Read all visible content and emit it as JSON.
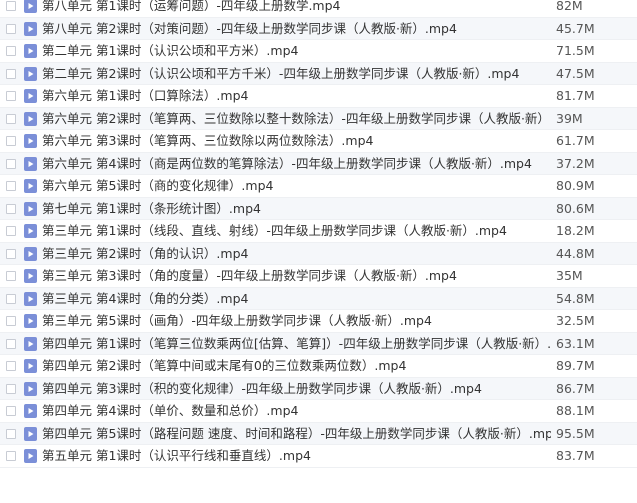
{
  "files": [
    {
      "name": "第八单元 第1课时（运筹问题）-四年级上册数学.mp4",
      "size": "82M",
      "icon": "video-file-icon"
    },
    {
      "name": "第八单元 第2课时（对策问题）-四年级上册数学同步课（人教版·新）.mp4",
      "size": "45.7M",
      "icon": "video-file-icon"
    },
    {
      "name": "第二单元 第1课时（认识公顷和平方米）.mp4",
      "size": "71.5M",
      "icon": "video-file-icon"
    },
    {
      "name": "第二单元 第2课时（认识公顷和平方千米）-四年级上册数学同步课（人教版·新）.mp4",
      "size": "47.5M",
      "icon": "video-file-icon"
    },
    {
      "name": "第六单元 第1课时（口算除法）.mp4",
      "size": "81.7M",
      "icon": "video-file-icon"
    },
    {
      "name": "第六单元 第2课时（笔算两、三位数除以整十数除法）-四年级上册数学同步课（人教版·新）.mp4",
      "size": "39M",
      "icon": "video-file-icon"
    },
    {
      "name": "第六单元 第3课时（笔算两、三位数除以两位数除法）.mp4",
      "size": "61.7M",
      "icon": "video-file-icon"
    },
    {
      "name": "第六单元 第4课时（商是两位数的笔算除法）-四年级上册数学同步课（人教版·新）.mp4",
      "size": "37.2M",
      "icon": "video-file-icon"
    },
    {
      "name": "第六单元 第5课时（商的变化规律）.mp4",
      "size": "80.9M",
      "icon": "video-file-icon"
    },
    {
      "name": "第七单元 第1课时（条形统计图）.mp4",
      "size": "80.6M",
      "icon": "video-file-icon"
    },
    {
      "name": "第三单元 第1课时（线段、直线、射线）-四年级上册数学同步课（人教版·新）.mp4",
      "size": "18.2M",
      "icon": "video-file-icon"
    },
    {
      "name": "第三单元 第2课时（角的认识）.mp4",
      "size": "44.8M",
      "icon": "video-file-icon"
    },
    {
      "name": "第三单元 第3课时（角的度量）-四年级上册数学同步课（人教版·新）.mp4",
      "size": "35M",
      "icon": "video-file-icon"
    },
    {
      "name": "第三单元 第4课时（角的分类）.mp4",
      "size": "54.8M",
      "icon": "video-file-icon"
    },
    {
      "name": "第三单元 第5课时（画角）-四年级上册数学同步课（人教版·新）.mp4",
      "size": "32.5M",
      "icon": "video-file-icon"
    },
    {
      "name": "第四单元 第1课时（笔算三位数乘两位[估算、笔算]）-四年级上册数学同步课（人教版·新）.mp4",
      "size": "63.1M",
      "icon": "video-file-icon"
    },
    {
      "name": "第四单元 第2课时（笔算中间或末尾有0的三位数乘两位数）.mp4",
      "size": "89.7M",
      "icon": "video-file-icon"
    },
    {
      "name": "第四单元 第3课时（积的变化规律）-四年级上册数学同步课（人教版·新）.mp4",
      "size": "86.7M",
      "icon": "video-file-icon"
    },
    {
      "name": "第四单元 第4课时（单价、数量和总价）.mp4",
      "size": "88.1M",
      "icon": "video-file-icon"
    },
    {
      "name": "第四单元 第5课时（路程问题 速度、时间和路程）-四年级上册数学同步课（人教版·新）.mp4",
      "size": "95.5M",
      "icon": "video-file-icon"
    },
    {
      "name": "第五单元 第1课时（认识平行线和垂直线）.mp4",
      "size": "83.7M",
      "icon": "video-file-icon"
    }
  ],
  "colors": {
    "icon_fill": "#7b8fd8",
    "icon_play": "#ffffff",
    "row_alt": "#f5f7fa",
    "divider": "#eef0f3"
  }
}
